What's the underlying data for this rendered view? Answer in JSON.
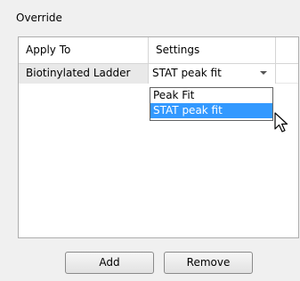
{
  "override": {
    "label": "Override",
    "columns": {
      "apply_to": "Apply To",
      "settings": "Settings"
    },
    "rows": [
      {
        "apply_to": "Biotinylated Ladder",
        "settings": "STAT peak fit"
      }
    ],
    "dropdown": {
      "options": [
        "Peak Fit",
        "STAT peak fit"
      ],
      "selected": "STAT peak fit"
    }
  },
  "buttons": {
    "add": "Add",
    "remove": "Remove"
  },
  "colors": {
    "selection": "#3399ff",
    "background": "#f0f0f0"
  }
}
